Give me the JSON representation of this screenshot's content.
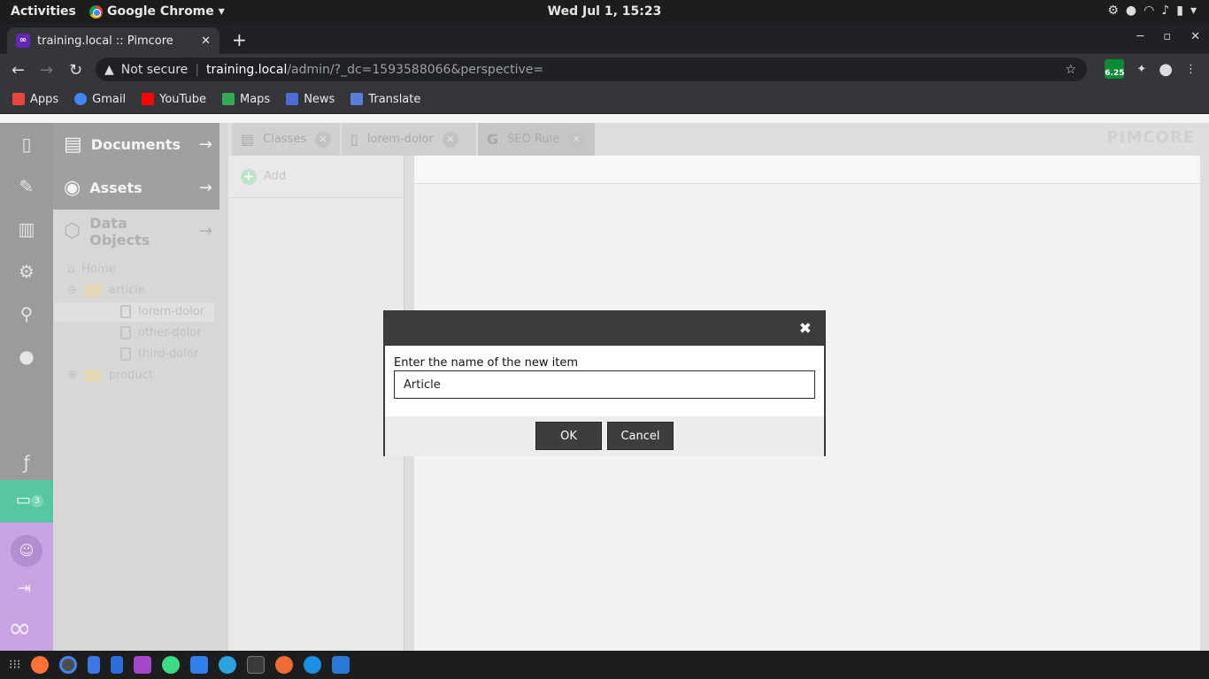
{
  "os": {
    "activities": "Activities",
    "app_name": "Google Chrome",
    "clock": "Wed Jul  1, 15:23"
  },
  "browser": {
    "tab_title": "training.local :: Pimcore",
    "tab_favicon": "∞",
    "security_label": "Not secure",
    "url_domain": "training.local",
    "url_path": "/admin/?_dc=1593588066&perspective=",
    "extension_badge": "6.25",
    "bookmarks": [
      {
        "label": "Apps",
        "color": "#e8453c"
      },
      {
        "label": "Gmail",
        "color": "#4285f4"
      },
      {
        "label": "YouTube",
        "color": "#ff0000"
      },
      {
        "label": "Maps",
        "color": "#34a853"
      },
      {
        "label": "News",
        "color": "#4a6cd4"
      },
      {
        "label": "Translate",
        "color": "#5b7fd6"
      }
    ]
  },
  "pimcore": {
    "logo": "PIMCORE",
    "notification_count": "3",
    "nav": {
      "documents": "Documents",
      "assets": "Assets",
      "data_objects": "Data Objects"
    },
    "tree": [
      {
        "label": "Home"
      },
      {
        "label": "article"
      },
      {
        "label": "lorem-dolor"
      },
      {
        "label": "other-dolor"
      },
      {
        "label": "third-dolor"
      },
      {
        "label": "product"
      }
    ],
    "tabs": [
      {
        "label": "Classes"
      },
      {
        "label": "lorem-dolor"
      },
      {
        "label": "SEO Rule"
      }
    ],
    "add_label": "Add"
  },
  "dialog": {
    "prompt": "Enter the name of the new item",
    "input_value": "Article",
    "ok_label": "OK",
    "cancel_label": "Cancel",
    "close_glyph": "✖"
  }
}
